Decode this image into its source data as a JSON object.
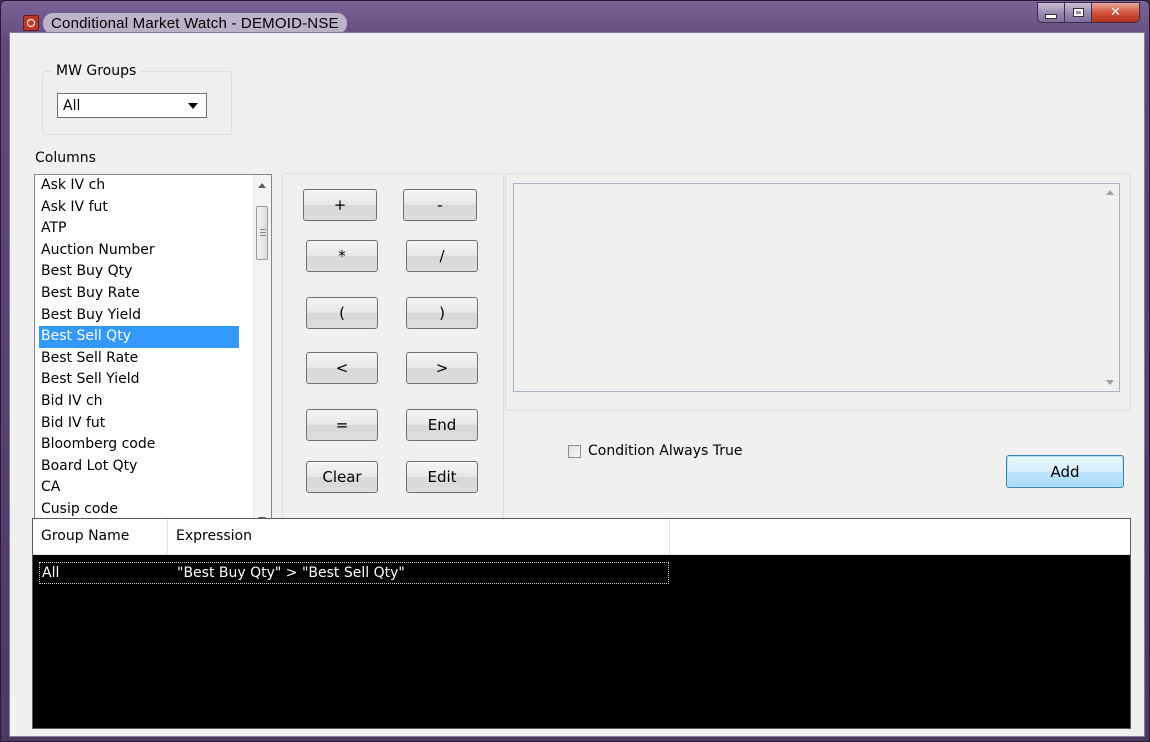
{
  "window": {
    "title": "Conditional Market Watch - DEMOID-NSE",
    "controls": {
      "minimize": "minimize-icon",
      "maximize": "maximize-icon",
      "close": "✕"
    }
  },
  "mw_groups": {
    "legend": "MW Groups",
    "selected": "All"
  },
  "columns": {
    "label": "Columns",
    "items": [
      "Ask IV ch",
      "Ask IV fut",
      "ATP",
      "Auction Number",
      "Best Buy Qty",
      "Best Buy Rate",
      "Best Buy Yield",
      "Best Sell Qty",
      "Best Sell Rate",
      "Best Sell Yield",
      "Bid IV ch",
      "Bid IV fut",
      "Bloomberg code",
      "Board Lot Qty",
      "CA",
      "Cusip code"
    ],
    "selected": "Best Sell Qty"
  },
  "operators": {
    "plus": "+",
    "minus": "-",
    "multiply": "*",
    "divide": "/",
    "open_paren": "(",
    "close_paren": ")",
    "less": "<",
    "greater": ">",
    "equals": "=",
    "end": "End",
    "clear": "Clear",
    "edit": "Edit"
  },
  "expression_box": {
    "value": ""
  },
  "condition_always_true": {
    "label": "Condition Always True",
    "checked": false
  },
  "add_button": "Add",
  "table": {
    "headers": [
      "Group Name",
      "Expression"
    ],
    "rows": [
      {
        "group": "All",
        "expression": "\"Best Buy Qty\" > \"Best Sell Qty\""
      }
    ]
  }
}
